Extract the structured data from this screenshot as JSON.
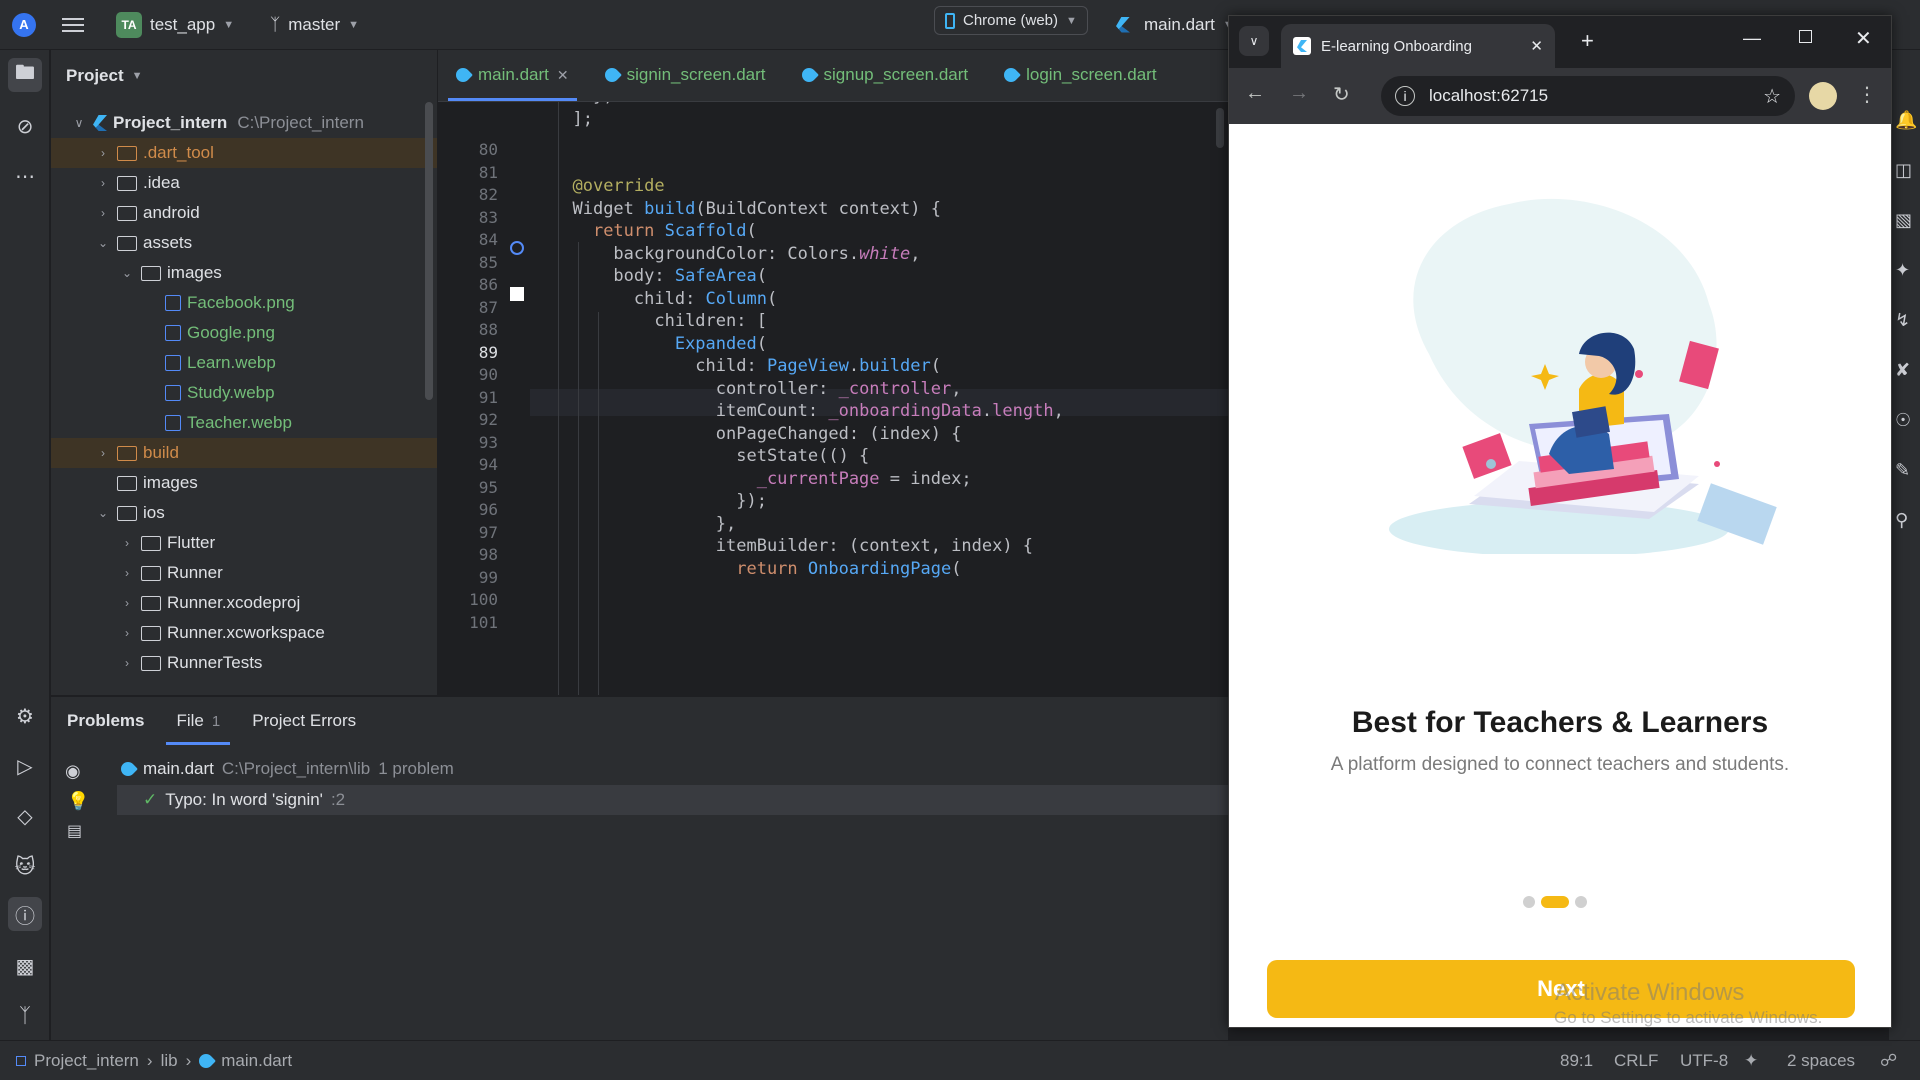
{
  "toolbar": {
    "project_initials": "TA",
    "project_name": "test_app",
    "branch": "master",
    "run_target": "Chrome (web)",
    "run_file": "main.dart"
  },
  "project_panel": {
    "title": "Project",
    "root_name": "Project_intern",
    "root_path": "C:\\Project_intern",
    "items": [
      {
        "label": ".dart_tool"
      },
      {
        "label": ".idea"
      },
      {
        "label": "android"
      },
      {
        "label": "assets"
      },
      {
        "label": "images"
      },
      {
        "label": "Facebook.png"
      },
      {
        "label": "Google.png"
      },
      {
        "label": "Learn.webp"
      },
      {
        "label": "Study.webp"
      },
      {
        "label": "Teacher.webp"
      },
      {
        "label": "build"
      },
      {
        "label": "images"
      },
      {
        "label": "ios"
      },
      {
        "label": "Flutter"
      },
      {
        "label": "Runner"
      },
      {
        "label": "Runner.xcodeproj"
      },
      {
        "label": "Runner.xcworkspace"
      },
      {
        "label": "RunnerTests"
      }
    ]
  },
  "editor": {
    "tabs": [
      {
        "label": "main.dart"
      },
      {
        "label": "signin_screen.dart"
      },
      {
        "label": "signup_screen.dart"
      },
      {
        "label": "login_screen.dart"
      }
    ],
    "line_numbers": [
      "80",
      "81",
      "82",
      "83",
      "84",
      "85",
      "86",
      "87",
      "88",
      "89",
      "90",
      "91",
      "92",
      "93",
      "94",
      "95",
      "96",
      "97",
      "98",
      "99",
      "100",
      "101"
    ],
    "current_line": "89"
  },
  "problems": {
    "tabs": [
      {
        "label": "Problems"
      },
      {
        "label": "File",
        "count": "1"
      },
      {
        "label": "Project Errors"
      }
    ],
    "file_name": "main.dart",
    "file_path": "C:\\Project_intern\\lib",
    "file_count": "1 problem",
    "issue_text": "Typo: In word 'signin'",
    "issue_line": ":2"
  },
  "statusbar": {
    "breadcrumb": [
      "Project_intern",
      "lib",
      "main.dart"
    ],
    "position": "89:1",
    "line_ending": "CRLF",
    "encoding": "UTF-8",
    "indent": "2 spaces"
  },
  "browser": {
    "tab_title": "E-learning Onboarding",
    "url": "localhost:62715",
    "page": {
      "title": "Best for Teachers & Learners",
      "subtitle": "A platform designed to connect teachers and students.",
      "dots": 3,
      "active_dot": 1,
      "button": "Next"
    }
  },
  "os": {
    "watermark_title": "Activate Windows",
    "watermark_sub": "Go to Settings to activate Windows."
  },
  "colors": {
    "accent": "#548af7",
    "button": "#f5b914",
    "file_green": "#73bd79"
  }
}
